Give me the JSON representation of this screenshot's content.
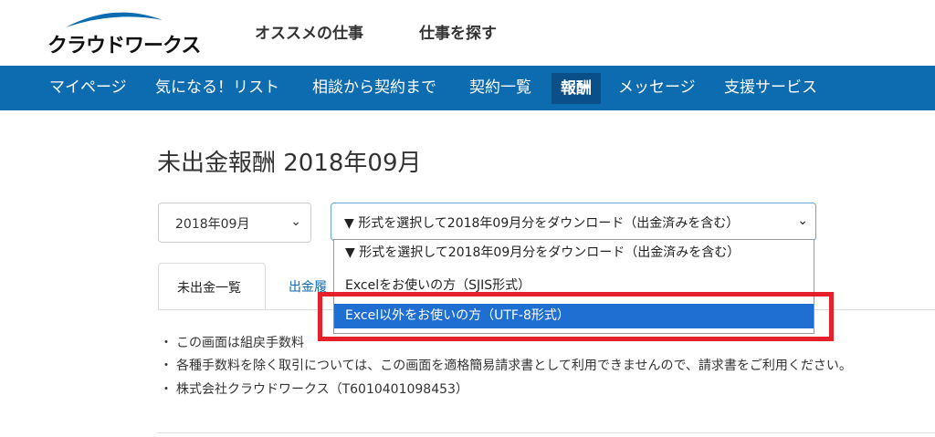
{
  "header": {
    "logo_text": "クラウドワークス",
    "links": [
      "オススメの仕事",
      "仕事を探す"
    ]
  },
  "nav": {
    "items": [
      "マイページ",
      "気になる！リスト",
      "相談から契約まで",
      "契約一覧",
      "報酬",
      "メッセージ",
      "支援サービス"
    ],
    "active": "報酬"
  },
  "page": {
    "title": "未出金報酬 2018年09月"
  },
  "month_select": {
    "value": "2018年09月",
    "chevron": "⌄"
  },
  "download_select": {
    "value": "▼ 形式を選択して2018年09月分をダウンロード（出金済みを含む）",
    "chevron": "⌄",
    "options": [
      "▼ 形式を選択して2018年09月分をダウンロード（出金済みを含む）",
      "Excelをお使いの方（SJIS形式）",
      "Excel以外をお使いの方（UTF-8形式）"
    ],
    "highlighted_index": 2
  },
  "tabs": [
    "未出金一覧",
    "出金履"
  ],
  "notes": [
    "この画面は組戻手数料",
    "各種手数料を除く取引については、この画面を適格簡易請求書として利用できませんので、請求書をご利用ください。",
    "株式会社クラウドワークス（T6010401098453）"
  ],
  "colors": {
    "brand": "#0d6bb0",
    "highlight": "#e6202a",
    "selected_option": "#1e6fd1"
  }
}
